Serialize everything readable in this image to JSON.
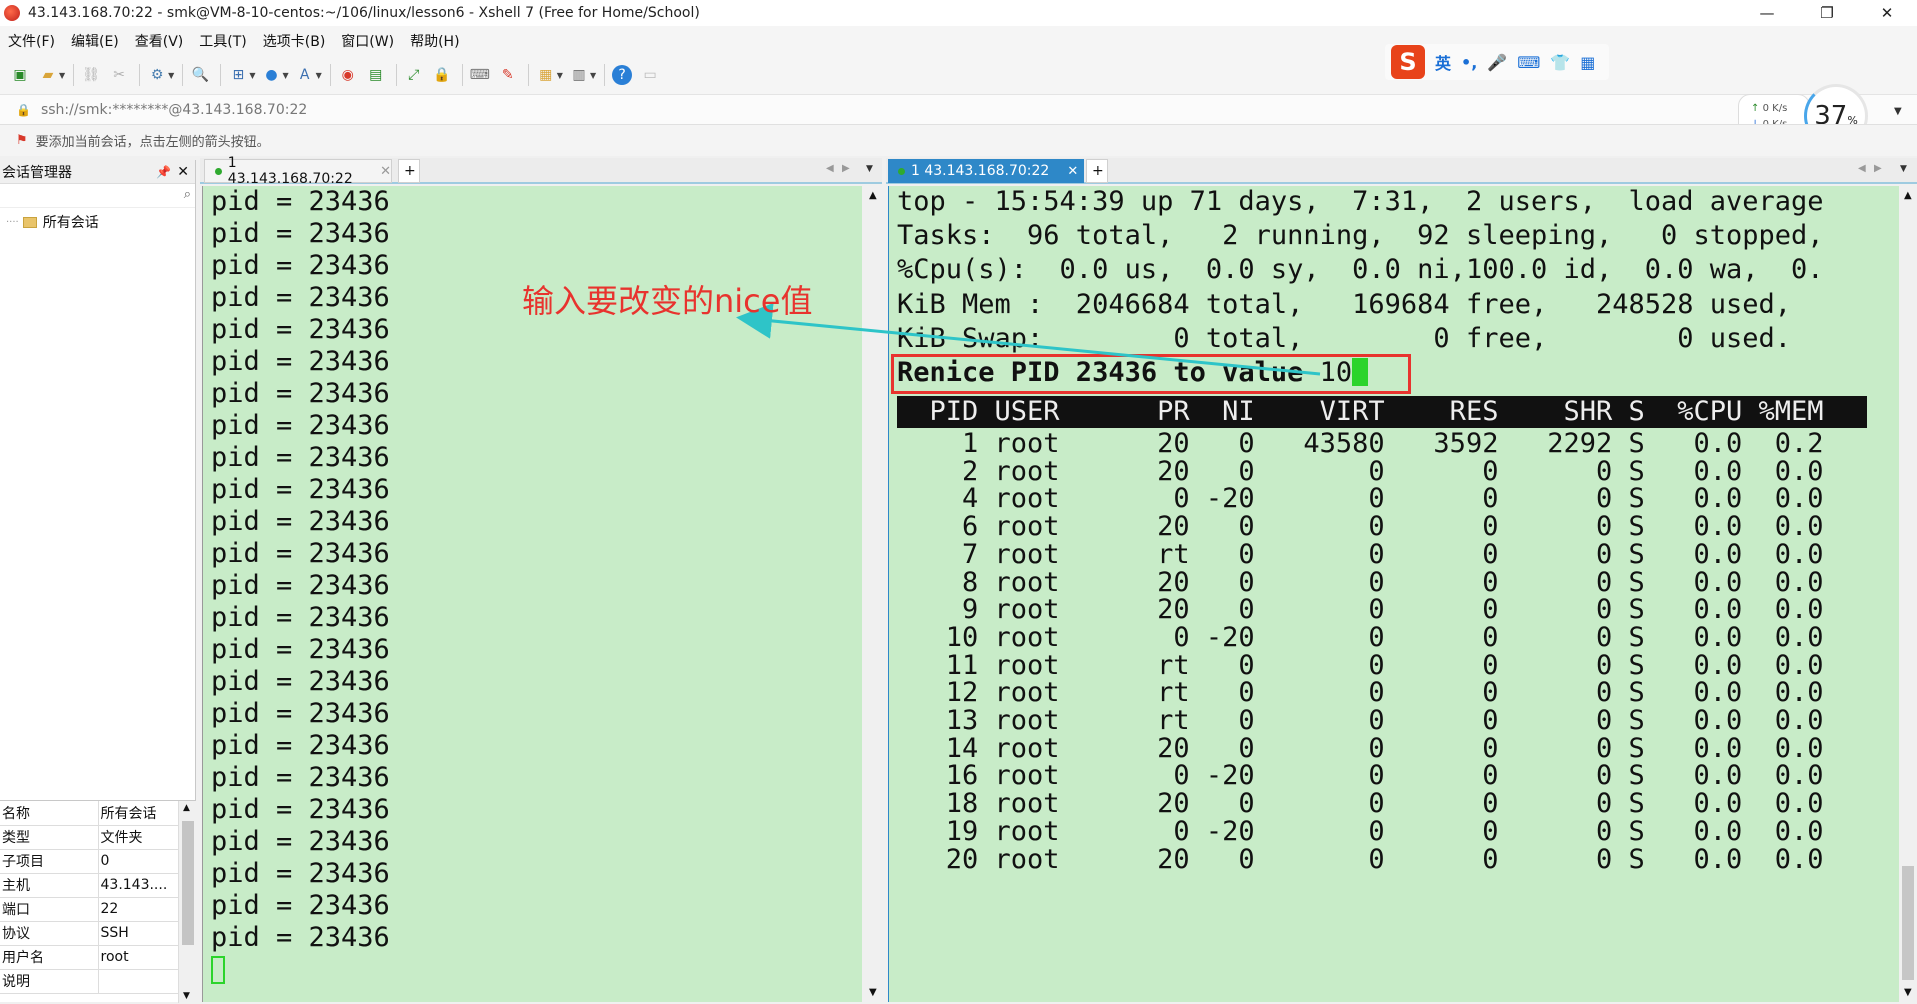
{
  "window": {
    "title": "43.143.168.70:22 - smk@VM-8-10-centos:~/106/linux/lesson6 - Xshell 7 (Free for Home/School)",
    "minimize": "—",
    "restore": "❐",
    "close": "✕"
  },
  "menu": [
    "文件(F)",
    "编辑(E)",
    "查看(V)",
    "工具(T)",
    "选项卡(B)",
    "窗口(W)",
    "帮助(H)"
  ],
  "ime": {
    "logo": "S",
    "lang": "英",
    "punct": "•,",
    "mic": "🎤",
    "kbd": "⌨",
    "shirt": "👕",
    "grid": "▦"
  },
  "address": {
    "text": "ssh://smk:********@43.143.168.70:22"
  },
  "hint": {
    "text": "要添加当前会话，点击左侧的箭头按钮。"
  },
  "speed": {
    "up": "0",
    "down": "0",
    "unit": "K/s",
    "percent": "37",
    "percent_sign": "%"
  },
  "session_manager": {
    "title": "会话管理器",
    "pin": "📌",
    "close": "✕",
    "tree_root": "所有会话",
    "properties": [
      {
        "key": "名称",
        "value": "所有会话"
      },
      {
        "key": "类型",
        "value": "文件夹"
      },
      {
        "key": "子项目",
        "value": "0"
      },
      {
        "key": "主机",
        "value": "43.143...."
      },
      {
        "key": "端口",
        "value": "22"
      },
      {
        "key": "协议",
        "value": "SSH"
      },
      {
        "key": "用户名",
        "value": "root"
      },
      {
        "key": "说明",
        "value": ""
      }
    ]
  },
  "left_tab": {
    "label": "1 43.143.168.70:22",
    "close": "✕",
    "add": "+"
  },
  "right_tab": {
    "label": "1 43.143.168.70:22",
    "close": "✕",
    "add": "+"
  },
  "left_terminal": {
    "lines": [
      "pid = 23436",
      "pid = 23436",
      "pid = 23436",
      "pid = 23436",
      "pid = 23436",
      "pid = 23436",
      "pid = 23436",
      "pid = 23436",
      "pid = 23436",
      "pid = 23436",
      "pid = 23436",
      "pid = 23436",
      "pid = 23436",
      "pid = 23436",
      "pid = 23436",
      "pid = 23436",
      "pid = 23436",
      "pid = 23436",
      "pid = 23436",
      "pid = 23436",
      "pid = 23436",
      "pid = 23436",
      "pid = 23436",
      "pid = 23436"
    ]
  },
  "right_terminal": {
    "summary": [
      "top - 15:54:39 up 71 days,  7:31,  2 users,  load average",
      "Tasks:  96 total,   2 running,  92 sleeping,   0 stopped,",
      "%Cpu(s):  0.0 us,  0.0 sy,  0.0 ni,100.0 id,  0.0 wa,  0.",
      "KiB Mem :  2046684 total,   169684 free,   248528 used,",
      "KiB Swap:        0 total,        0 free,        0 used."
    ],
    "prompt": "Renice PID 23436 to value",
    "prompt_value": "10",
    "header": "  PID USER      PR  NI    VIRT    RES    SHR S  %CPU %MEM",
    "processes": [
      "    1 root      20   0   43580   3592   2292 S   0.0  0.2",
      "    2 root      20   0       0      0      0 S   0.0  0.0",
      "    4 root       0 -20       0      0      0 S   0.0  0.0",
      "    6 root      20   0       0      0      0 S   0.0  0.0",
      "    7 root      rt   0       0      0      0 S   0.0  0.0",
      "    8 root      20   0       0      0      0 S   0.0  0.0",
      "    9 root      20   0       0      0      0 S   0.0  0.0",
      "   10 root       0 -20       0      0      0 S   0.0  0.0",
      "   11 root      rt   0       0      0      0 S   0.0  0.0",
      "   12 root      rt   0       0      0      0 S   0.0  0.0",
      "   13 root      rt   0       0      0      0 S   0.0  0.0",
      "   14 root      20   0       0      0      0 S   0.0  0.0",
      "   16 root       0 -20       0      0      0 S   0.0  0.0",
      "   18 root      20   0       0      0      0 S   0.0  0.0",
      "   19 root       0 -20       0      0      0 S   0.0  0.0",
      "   20 root      20   0       0      0      0 S   0.0  0.0"
    ]
  },
  "annotation": {
    "text": "输入要改变的nice值",
    "color": "#e8332e",
    "arrow_color": "#2ec4c8"
  },
  "colors": {
    "terminal_bg": "#c8ecc8",
    "cursor": "#2bd42b",
    "highlight": "#e8332e"
  }
}
